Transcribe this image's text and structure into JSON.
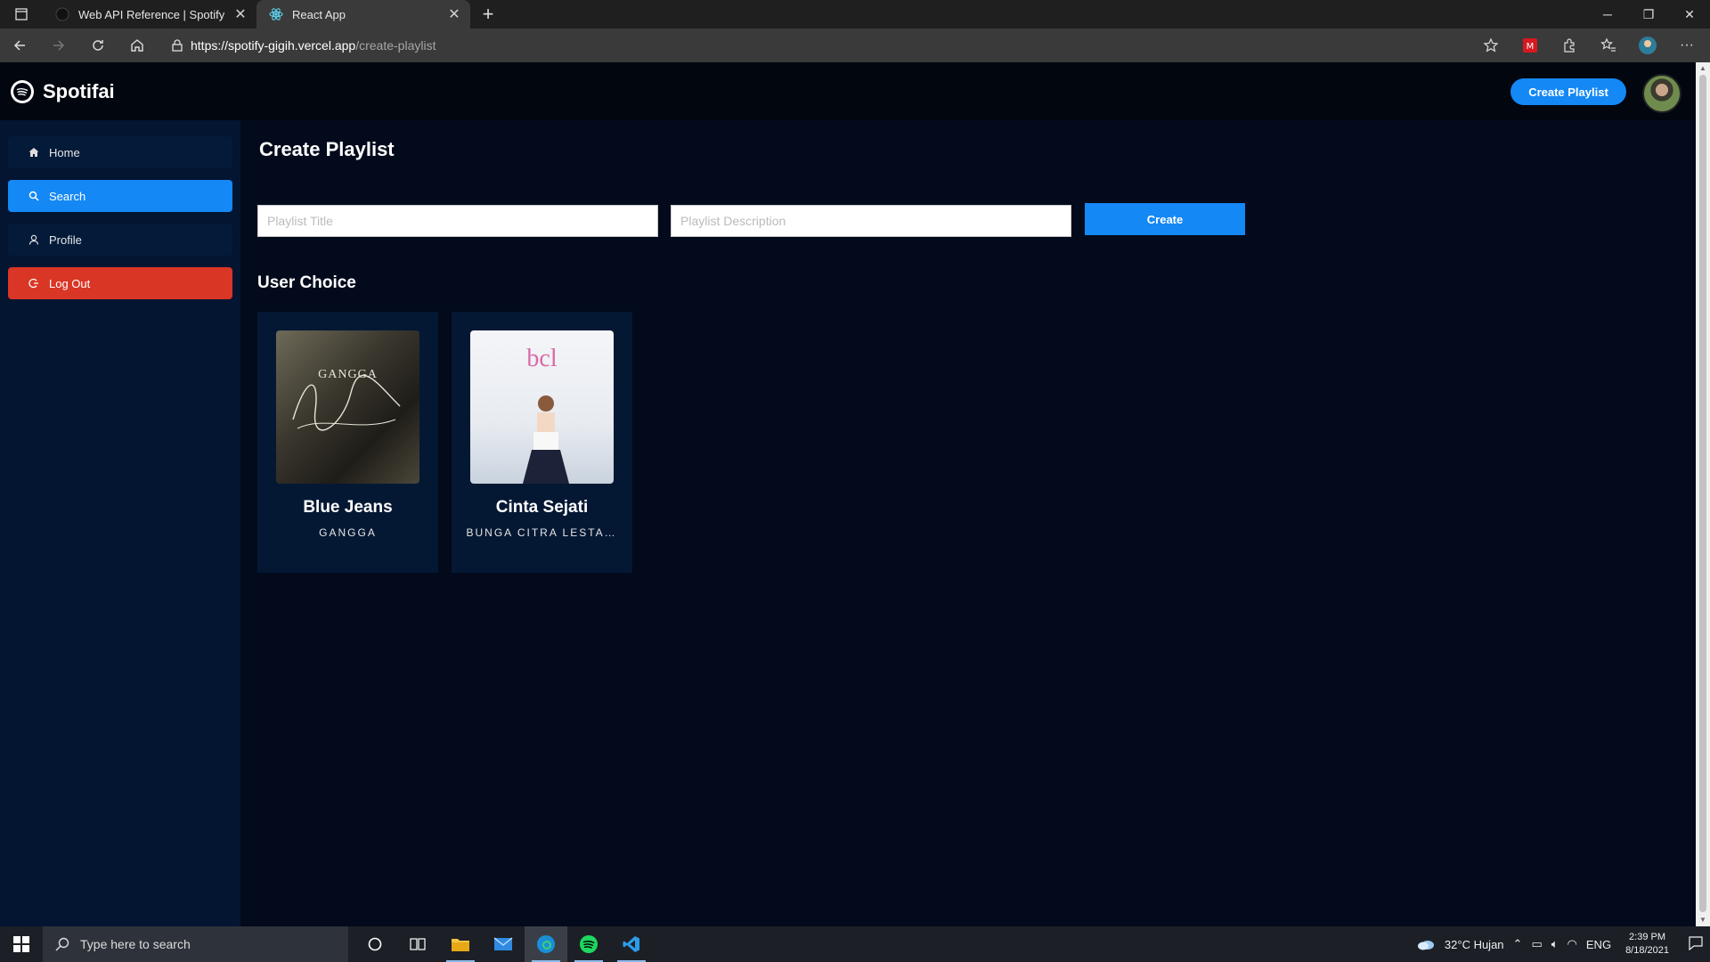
{
  "browser": {
    "tabs": [
      {
        "title": "Web API Reference | Spotify for Developers",
        "active": false
      },
      {
        "title": "React App",
        "active": true
      }
    ],
    "url_host": "https://spotify-gigih.vercel.app",
    "url_path": "/create-playlist"
  },
  "app": {
    "brand": "Spotifai",
    "header_button": "Create Playlist",
    "sidebar": {
      "items": [
        {
          "label": "Home",
          "icon": "home-icon",
          "active": false
        },
        {
          "label": "Search",
          "icon": "search-icon",
          "active": true
        },
        {
          "label": "Profile",
          "icon": "user-icon",
          "active": false
        },
        {
          "label": "Log Out",
          "icon": "logout-icon",
          "active": false
        }
      ]
    },
    "page_title": "Create Playlist",
    "form": {
      "title_placeholder": "Playlist Title",
      "title_value": "",
      "description_placeholder": "Playlist Description",
      "description_value": "",
      "submit_label": "Create"
    },
    "section_title": "User Choice",
    "cards": [
      {
        "title": "Blue Jeans",
        "artist": "GANGGA",
        "cover_text": "GANGGA"
      },
      {
        "title": "Cinta Sejati",
        "artist": "BUNGA CITRA LESTA...",
        "cover_text": "bcl"
      }
    ],
    "colors": {
      "accent": "#1488f5",
      "danger": "#d93626",
      "background": "#020a1c",
      "sidebar": "#031531"
    }
  },
  "taskbar": {
    "search_placeholder": "Type here to search",
    "weather": "32°C  Hujan",
    "language": "ENG",
    "time": "2:39 PM",
    "date": "8/18/2021"
  }
}
